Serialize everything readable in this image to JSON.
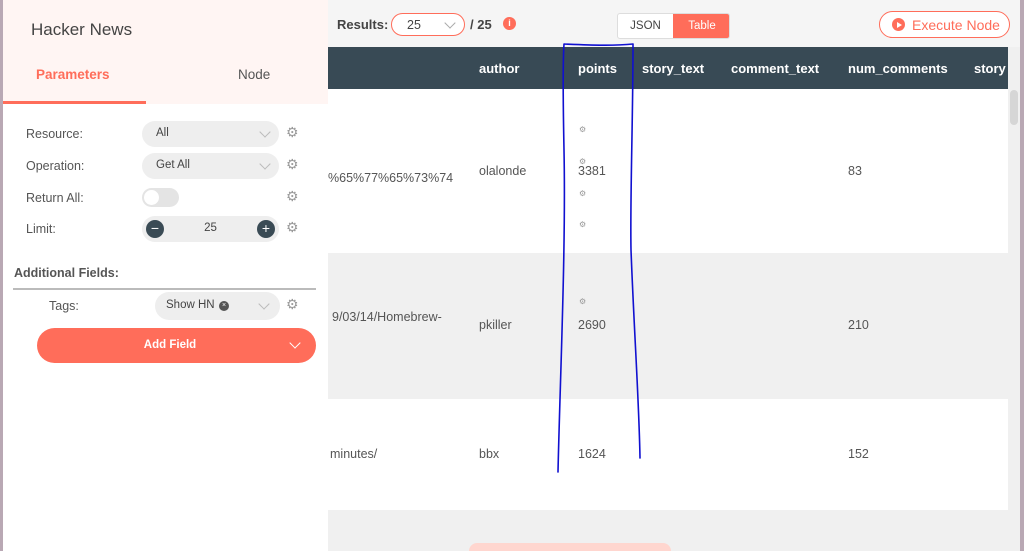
{
  "panel": {
    "title": "Hacker News",
    "tabs": {
      "parameters": "Parameters",
      "node": "Node"
    },
    "params": {
      "resource": {
        "label": "Resource:",
        "value": "All"
      },
      "operation": {
        "label": "Operation:",
        "value": "Get All"
      },
      "return_all": {
        "label": "Return All:",
        "on": false
      },
      "limit": {
        "label": "Limit:",
        "value": "25",
        "minus": "−",
        "plus": "+"
      }
    },
    "additional_fields": {
      "label": "Additional Fields:",
      "tags": {
        "label": "Tags:",
        "chip": "Show HN",
        "chip_remove": "×"
      },
      "add_field_label": "Add Field"
    }
  },
  "topbar": {
    "results_label": "Results:",
    "results_value": "25",
    "results_total": "/ 25",
    "info_icon": "i",
    "view_json": "JSON",
    "view_table": "Table",
    "execute_label": "Execute Node"
  },
  "table": {
    "columns": [
      "author",
      "points",
      "story_text",
      "comment_text",
      "num_comments",
      "story"
    ],
    "rows": [
      {
        "url_fragment": "%65%77%65%73%74",
        "author": "olalonde",
        "points": "3381",
        "story_text": "",
        "comment_text": "",
        "num_comments": "83"
      },
      {
        "url_fragment": "9/03/14/Homebrew-",
        "author": "pkiller",
        "points": "2690",
        "story_text": "",
        "comment_text": "",
        "num_comments": "210"
      },
      {
        "url_fragment": "minutes/",
        "author": "bbx",
        "points": "1624",
        "story_text": "",
        "comment_text": "",
        "num_comments": "152"
      }
    ]
  },
  "colors": {
    "accent": "#ff6d5a",
    "header": "#384a55",
    "annotation": "#1010d0"
  }
}
